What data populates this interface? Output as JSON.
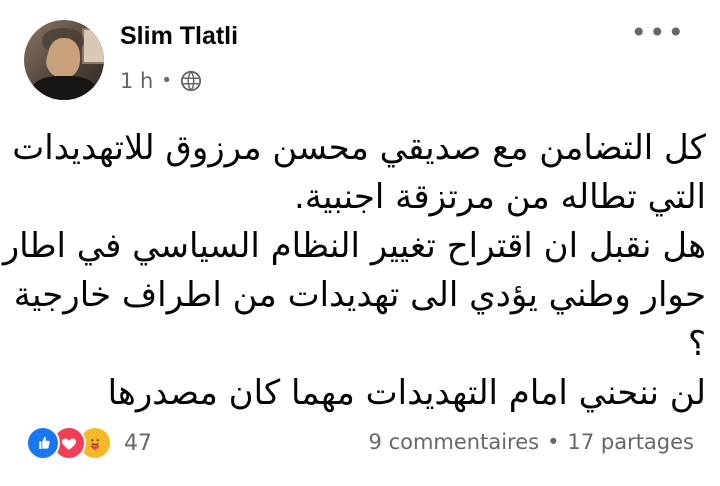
{
  "header": {
    "author": "Slim Tlatli",
    "time": "1 h",
    "separator": "•",
    "privacy_icon": "globe-icon",
    "more_label": "•••"
  },
  "post": {
    "lines": [
      "كل التضامن مع صديقي محسن مرزوق   للاتهديدات",
      "التي تطاله من مرتزقة اجنبية.",
      "هل نقبل ان اقتراح تغيير النظام السياسي في اطار",
      "حوار وطني يؤدي الى تهديدات من اطراف خارجية",
      "؟",
      "لن ننحني امام التهديدات مهما كان مصدرها"
    ]
  },
  "footer": {
    "reactions": [
      "like-icon",
      "love-icon",
      "care-icon"
    ],
    "reaction_count": "47",
    "comments": "9 commentaires",
    "separator": "•",
    "shares": "17 partages"
  },
  "colors": {
    "like": "#1877f2",
    "love": "#f33e58",
    "care": "#f7b928",
    "meta_text": "#65676b"
  }
}
